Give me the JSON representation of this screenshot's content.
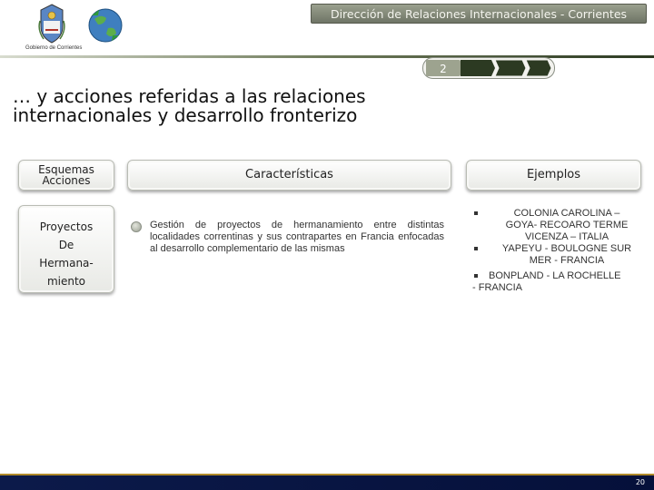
{
  "header": {
    "title": "Dirección de Relaciones Internacionales - Corrientes",
    "logo_caption": "Gobierno de Corrientes"
  },
  "pager": {
    "current": "2"
  },
  "slide": {
    "title_line1": "… y acciones referidas a las relaciones",
    "title_line2": "internacionales y desarrollo fronterizo"
  },
  "table": {
    "col1_header_line1": "Esquemas",
    "col1_header_line2": "Acciones",
    "col2_header": "Características",
    "col3_header": "Ejemplos",
    "row_label_line1": "Proyectos",
    "row_label_line2": "De",
    "row_label_line3": "Hermana-",
    "row_label_line4": "miento",
    "description": "Gestión de proyectos de hermanamiento entre distintas localidades correntinas y sus contrapartes en Francia enfocadas al desarrollo complementario de las mismas",
    "examples": [
      {
        "line1": "COLONIA CAROLINA –",
        "line2": "GOYA- RECOARO TERME",
        "line3": "VICENZA – ITALIA"
      },
      {
        "line1": "YAPEYU - BOULOGNE SUR",
        "line2": "MER - FRANCIA"
      },
      {
        "line1": "BONPLAND - LA ROCHELLE",
        "line2": "- FRANCIA"
      }
    ]
  },
  "footer": {
    "page_number": "20"
  },
  "colors": {
    "header_bar": "#7d8374",
    "footer_bar": "#0c1a4a",
    "footer_accent": "#b08a2a"
  }
}
